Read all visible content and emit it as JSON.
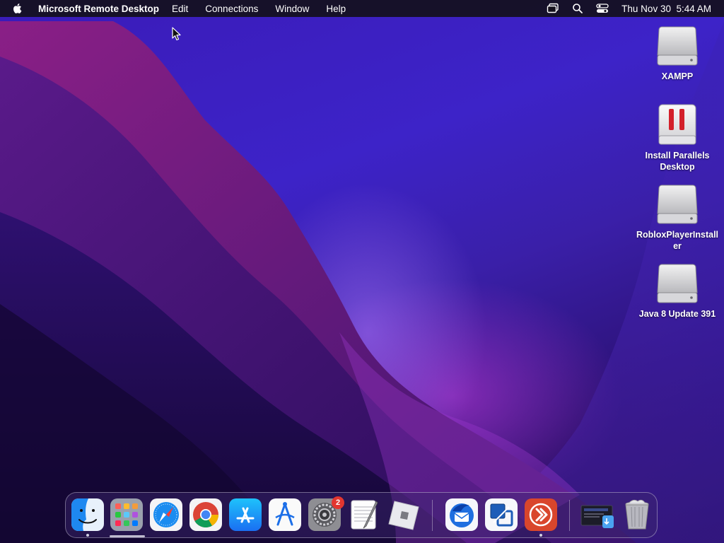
{
  "menubar": {
    "app_name": "Microsoft Remote Desktop",
    "menus": [
      "Edit",
      "Connections",
      "Window",
      "Help"
    ],
    "datetime": "Thu Nov 30  5:44 AM",
    "status_icons": [
      "screen-mirroring-icon",
      "spotlight-search-icon",
      "control-center-icon"
    ]
  },
  "desktop": {
    "icons": [
      {
        "label": "XAMPP",
        "icon": "disk-image-icon"
      },
      {
        "label": "Install Parallels Desktop",
        "icon": "parallels-installer-icon"
      },
      {
        "label": "RobloxPlayerInstaller",
        "icon": "disk-image-icon"
      },
      {
        "label": "Java 8 Update 391",
        "icon": "disk-image-icon"
      }
    ]
  },
  "dock": {
    "apps": [
      {
        "name": "Finder",
        "icon": "finder-icon",
        "running": true
      },
      {
        "name": "Launchpad",
        "icon": "launchpad-icon",
        "running": false
      },
      {
        "name": "Safari",
        "icon": "safari-icon",
        "running": false
      },
      {
        "name": "Google Chrome",
        "icon": "chrome-icon",
        "running": false
      },
      {
        "name": "App Store",
        "icon": "app-store-icon",
        "running": false
      },
      {
        "name": "Instruments",
        "icon": "instruments-icon",
        "running": false
      },
      {
        "name": "System Settings",
        "icon": "system-settings-icon",
        "running": false,
        "badge": "2"
      },
      {
        "name": "TextEdit",
        "icon": "textedit-icon",
        "running": false
      },
      {
        "name": "Roblox",
        "icon": "roblox-icon",
        "running": false
      },
      {
        "name": "Thunderbird",
        "icon": "thunderbird-icon",
        "running": false
      },
      {
        "name": "VirtualBox",
        "icon": "virtualbox-icon",
        "running": false
      },
      {
        "name": "Microsoft Remote Desktop",
        "icon": "remote-desktop-icon",
        "running": true
      },
      {
        "name": "Downloads",
        "icon": "downloads-stack-icon",
        "running": false
      },
      {
        "name": "Trash",
        "icon": "trash-icon",
        "running": false
      }
    ]
  },
  "colors": {
    "menubar_bg": "#14101c",
    "wallpaper_base": "#3a1bb8",
    "badge": "#e3362f",
    "remote_desktop": "#d9462c"
  }
}
